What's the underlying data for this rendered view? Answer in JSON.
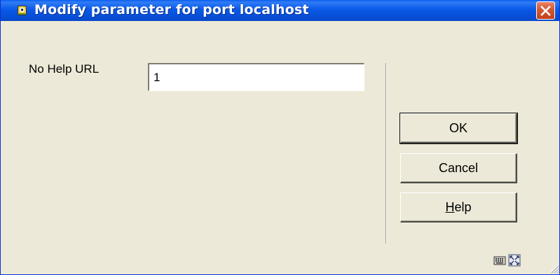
{
  "window": {
    "title": "Modify parameter for port localhost",
    "icon": "app-icon",
    "close_icon": "close-icon"
  },
  "form": {
    "field_label": "No Help URL",
    "field_value": "1"
  },
  "buttons": {
    "ok_label": "OK",
    "cancel_label": "Cancel",
    "help_mnemonic": "H",
    "help_rest": "elp"
  },
  "status": {
    "icons": [
      "keyboard-icon",
      "resize-window-icon",
      "size-grip-icon"
    ]
  },
  "colors": {
    "titlebar": "#0a59e8",
    "dialog_bg": "#ece9d8",
    "close_button": "#d55a32"
  }
}
